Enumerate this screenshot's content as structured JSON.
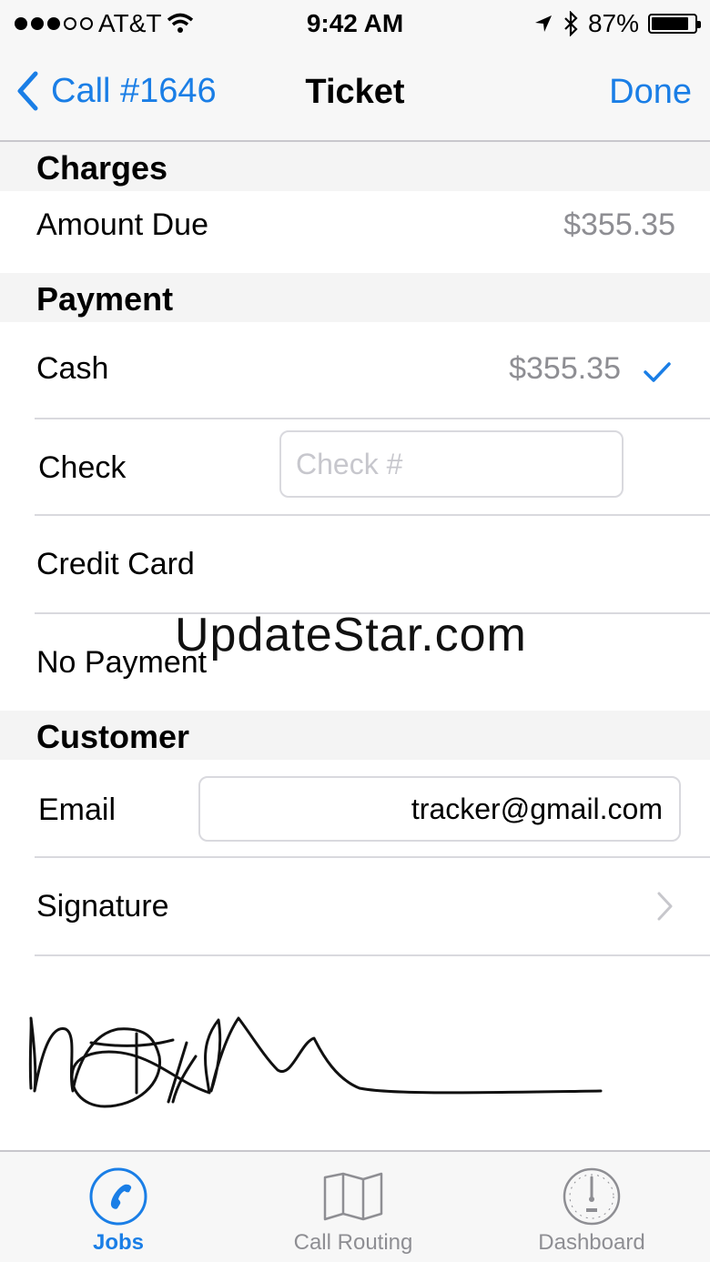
{
  "status_bar": {
    "carrier": "AT&T",
    "time": "9:42 AM",
    "battery": "87%",
    "battery_level": 0.87,
    "icons": [
      "signal-dots-icon",
      "wifi-icon",
      "location-arrow-icon",
      "bluetooth-icon",
      "battery-icon"
    ]
  },
  "nav": {
    "back_label": "Call #1646",
    "title": "Ticket",
    "done_label": "Done"
  },
  "charges": {
    "header": "Charges",
    "amount_due_label": "Amount Due",
    "amount_due_value": "$355.35"
  },
  "payment": {
    "header": "Payment",
    "cash_label": "Cash",
    "cash_value": "$355.35",
    "check_label": "Check",
    "check_placeholder": "Check #",
    "credit_card_label": "Credit Card",
    "no_payment_label": "No Payment"
  },
  "customer": {
    "header": "Customer",
    "email_label": "Email",
    "email_value": "tracker@gmail.com",
    "signature_label": "Signature"
  },
  "watermark": "UpdateStar.com",
  "tabbar": {
    "tabs": [
      {
        "label": "Jobs",
        "icon": "phone-circle-icon",
        "active": true
      },
      {
        "label": "Call Routing",
        "icon": "map-icon",
        "active": false
      },
      {
        "label": "Dashboard",
        "icon": "gauge-icon",
        "active": false
      }
    ]
  },
  "colors": {
    "accent": "#1a7ee6",
    "secondary_text": "#8e8e93",
    "section_background": "#f4f4f4",
    "bar_background": "#f7f7f7"
  }
}
